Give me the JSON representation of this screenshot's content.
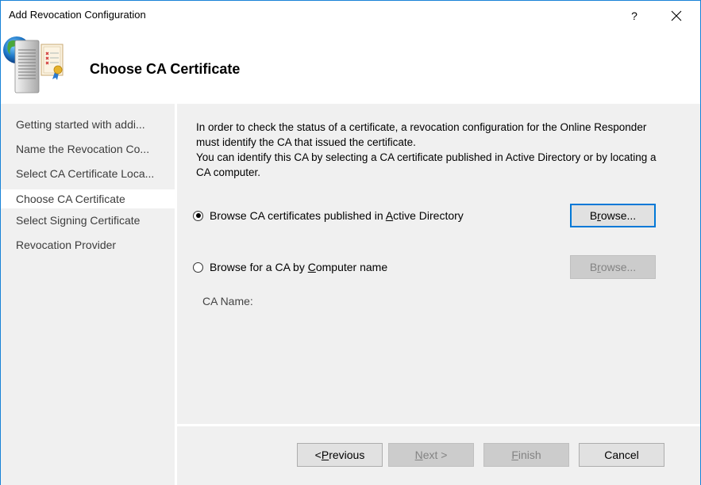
{
  "window": {
    "title": "Add Revocation Configuration",
    "help_label": "?",
    "close_label": "✕",
    "accent": "#1883d7"
  },
  "header": {
    "icon": "server-certificate-globe-icon",
    "title": "Choose CA Certificate"
  },
  "nav": {
    "items": [
      {
        "label": "Getting started with addi...",
        "active": false
      },
      {
        "label": "Name the Revocation Co...",
        "active": false
      },
      {
        "label": "Select CA Certificate Loca...",
        "active": false
      },
      {
        "label": "Choose CA Certificate",
        "active": true
      },
      {
        "label": "Select Signing Certificate",
        "active": false
      },
      {
        "label": "Revocation Provider",
        "active": false
      }
    ]
  },
  "content": {
    "description_1": "In order to check the status of a certificate, a revocation configuration for the Online Responder must identify the CA that issued the certificate.",
    "description_2": "You can identify this CA by selecting a CA certificate published in Active Directory or by locating a CA computer.",
    "option_ad": {
      "label_pre": "Browse CA certificates published in ",
      "label_accel": "A",
      "label_post": "ctive Directory",
      "checked": true,
      "browse_pre": "B",
      "browse_accel": "r",
      "browse_post": "owse...",
      "browse_enabled": true
    },
    "option_computer": {
      "label_pre": "Browse for a CA by ",
      "label_accel": "C",
      "label_post": "omputer name",
      "checked": false,
      "browse_pre": "B",
      "browse_accel": "r",
      "browse_post": "owse...",
      "browse_enabled": false
    },
    "ca_name_label": "CA Name:"
  },
  "footer": {
    "previous": {
      "pre": "< ",
      "accel": "P",
      "post": "revious",
      "enabled": true
    },
    "next": {
      "pre": "",
      "accel": "N",
      "post": "ext >",
      "enabled": false
    },
    "finish": {
      "pre": "",
      "accel": "F",
      "post": "inish",
      "enabled": false
    },
    "cancel": {
      "label": "Cancel",
      "enabled": true
    }
  }
}
